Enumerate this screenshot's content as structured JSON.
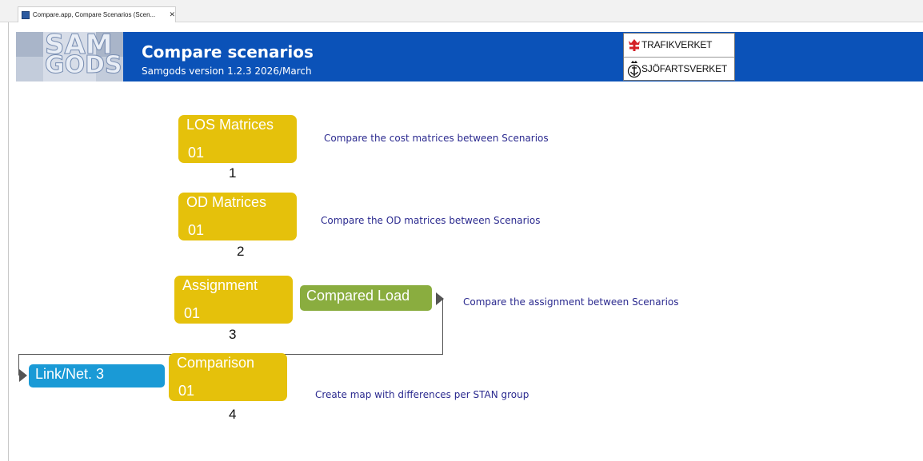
{
  "tab": {
    "title": "Compare.app, Compare Scenarios (Scen...",
    "close": "✕"
  },
  "header": {
    "logo_line1": "SAM",
    "logo_line2": "GODS",
    "title": "Compare scenarios",
    "subtitle": "Samgods version 1.2.3 2026/March",
    "agency1": "TRAFIKVERKET",
    "agency2": "SJÖFARTSVERKET",
    "header_color": "#0b52b8"
  },
  "steps": [
    {
      "name": "LOS Matrices",
      "num": "01",
      "index": "1",
      "desc": "Compare the cost matrices between Scenarios"
    },
    {
      "name": "OD Matrices",
      "num": "01",
      "index": "2",
      "desc": "Compare the OD matrices between Scenarios"
    },
    {
      "name": "Assignment",
      "num": "01",
      "index": "3",
      "desc": "Compare the assignment between Scenarios",
      "output": "Compared Load"
    },
    {
      "name": "Comparison",
      "num": "01",
      "index": "4",
      "desc": "Create map with differences per STAN group",
      "input": "Link/Net. 3"
    }
  ],
  "colors": {
    "block": "#e5c10b",
    "output_pill": "#8aad3f",
    "input_pill": "#1a9ad6",
    "desc_text": "#2b2a8f"
  },
  "icons": {
    "tab_icon": "app-icon",
    "trafikverket_crest": "crown-cross-icon",
    "sjofartsverket_crest": "anchor-crown-icon"
  }
}
